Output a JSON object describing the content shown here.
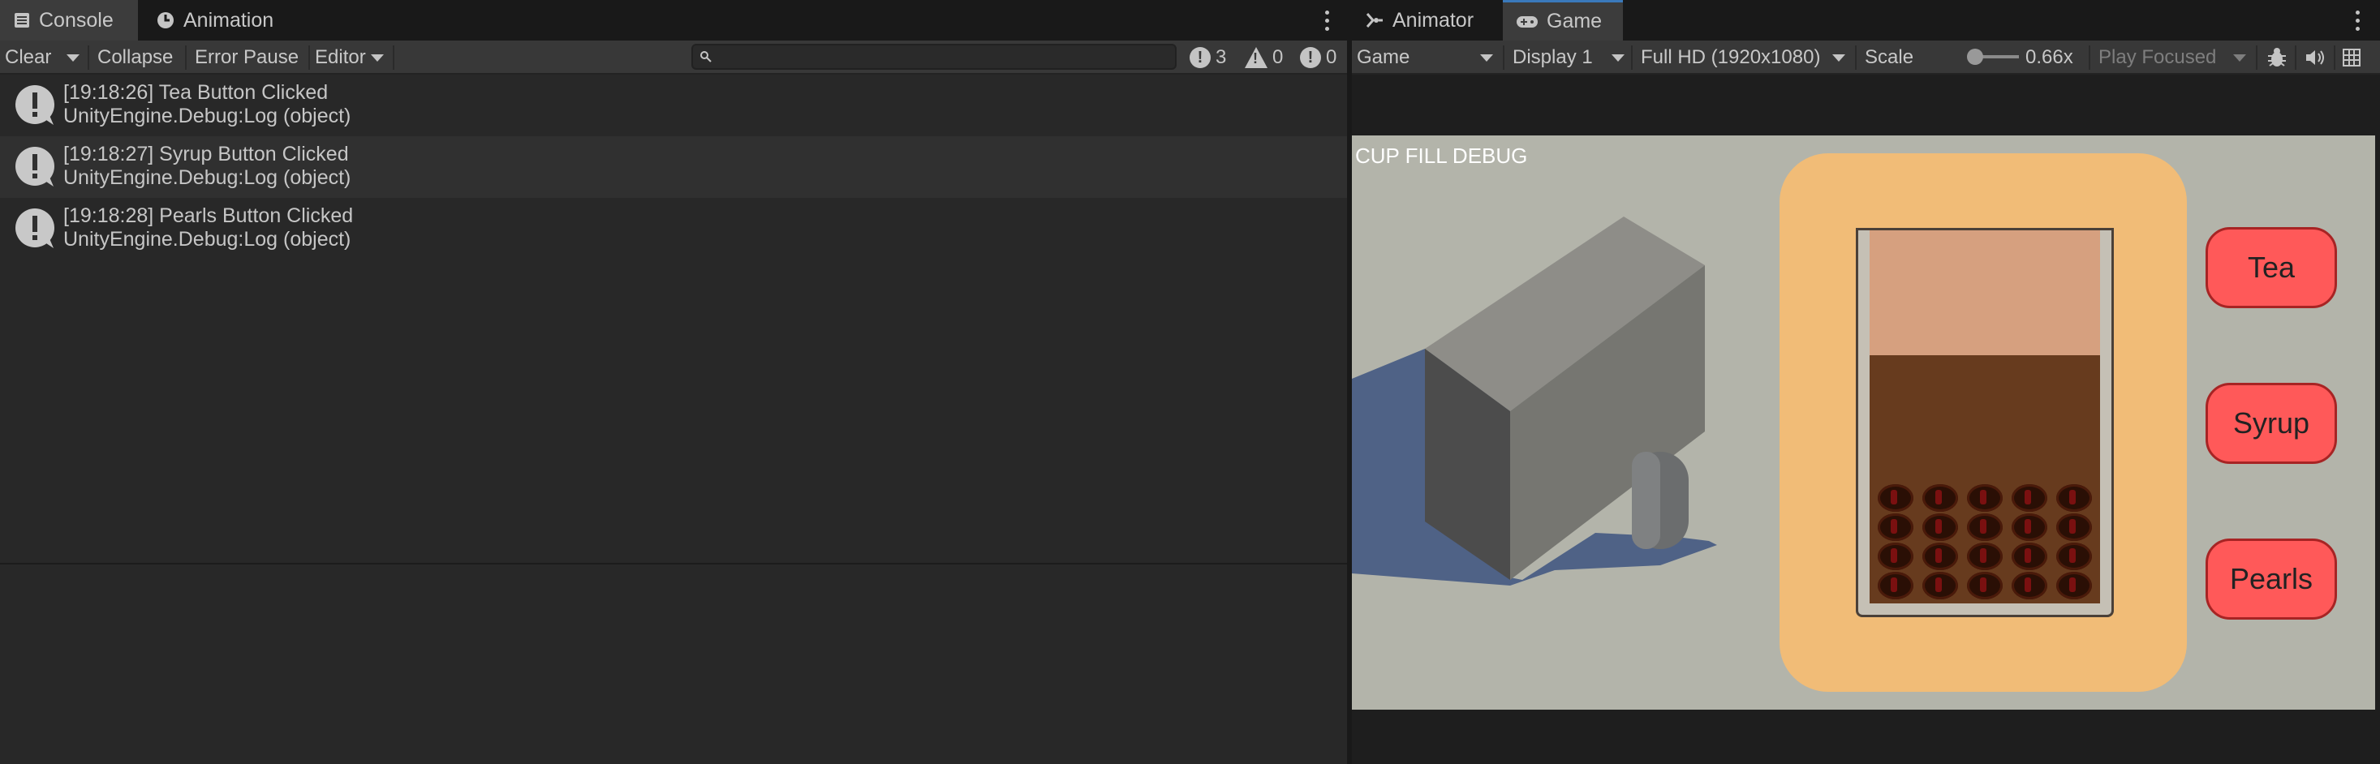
{
  "left_panel": {
    "tabs": [
      {
        "label": "Console",
        "icon": "console-icon"
      },
      {
        "label": "Animation",
        "icon": "animation-clock-icon"
      }
    ],
    "toolbar": {
      "clear": "Clear",
      "collapse": "Collapse",
      "error_pause": "Error Pause",
      "editor": "Editor",
      "search_value": "",
      "counts": {
        "info": "3",
        "warnings": "0",
        "errors": "0"
      }
    },
    "logs": [
      {
        "line1": "[19:18:26] Tea Button Clicked",
        "line2": "UnityEngine.Debug:Log (object)"
      },
      {
        "line1": "[19:18:27] Syrup Button Clicked",
        "line2": "UnityEngine.Debug:Log (object)"
      },
      {
        "line1": "[19:18:28] Pearls Button Clicked",
        "line2": "UnityEngine.Debug:Log (object)"
      }
    ]
  },
  "right_panel": {
    "tabs": [
      {
        "label": "Animator",
        "icon": "animator-icon"
      },
      {
        "label": "Game",
        "icon": "gamepad-icon"
      }
    ],
    "toolbar": {
      "view": "Game",
      "display": "Display 1",
      "resolution": "Full HD (1920x1080)",
      "scale_label": "Scale",
      "scale_value": "0.66x",
      "scale_fraction": 0.0,
      "play_mode": "Play Focused"
    },
    "game": {
      "debug_label": "CUP FILL DEBUG",
      "buttons": {
        "tea": "Tea",
        "syrup": "Syrup",
        "pearls": "Pearls"
      },
      "colors": {
        "panel": "#f1bc77",
        "tea_top": "#d6a07f",
        "tea_body": "#673b1e",
        "button": "#ff5959"
      }
    }
  }
}
